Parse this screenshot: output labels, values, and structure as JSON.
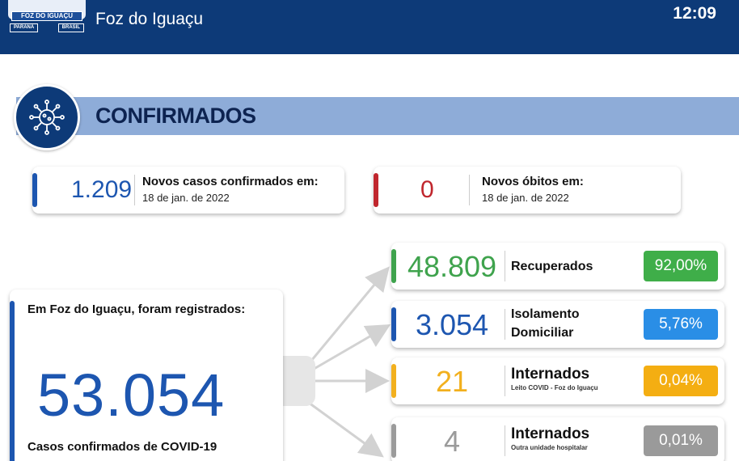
{
  "header": {
    "logo": {
      "name": "FOZ DO IGUAÇU",
      "left": "PARANÁ",
      "right": "BRASIL"
    },
    "city": "Foz do Iguaçu",
    "time": "12:09"
  },
  "section": {
    "title": "CONFIRMADOS",
    "icon": "virus-icon"
  },
  "new_cases": {
    "value": "1.209",
    "label": "Novos casos confirmados em:",
    "date": "18 de jan. de 2022",
    "color": "#1d56b0"
  },
  "new_deaths": {
    "value": "0",
    "label": "Novos óbitos em:",
    "date": "18 de jan. de 2022",
    "color": "#c0262d"
  },
  "total": {
    "intro": "Em Foz do Iguaçu, foram registrados:",
    "value": "53.054",
    "caption": "Casos confirmados de COVID-19",
    "color": "#1d56b0"
  },
  "stats": [
    {
      "value": "48.809",
      "label": "Recuperados",
      "label2": "",
      "sub": "",
      "pct": "92,00%",
      "color": "#3fa34d",
      "pct_color": "#3fae49"
    },
    {
      "value": "3.054",
      "label": "Isolamento",
      "label2": "Domiciliar",
      "sub": "",
      "pct": "5,76%",
      "color": "#1d56b0",
      "pct_color": "#2a8ee6"
    },
    {
      "value": "21",
      "label": "Internados",
      "label2": "",
      "sub": "Leito COVID - Foz do Iguaçu",
      "pct": "0,04%",
      "color": "#f2b01e",
      "pct_color": "#f4ae12"
    },
    {
      "value": "4",
      "label": "Internados",
      "label2": "",
      "sub": "Outra unidade hospitalar",
      "pct": "0,01%",
      "color": "#9b9b9b",
      "pct_color": "#9a9a9a"
    }
  ]
}
